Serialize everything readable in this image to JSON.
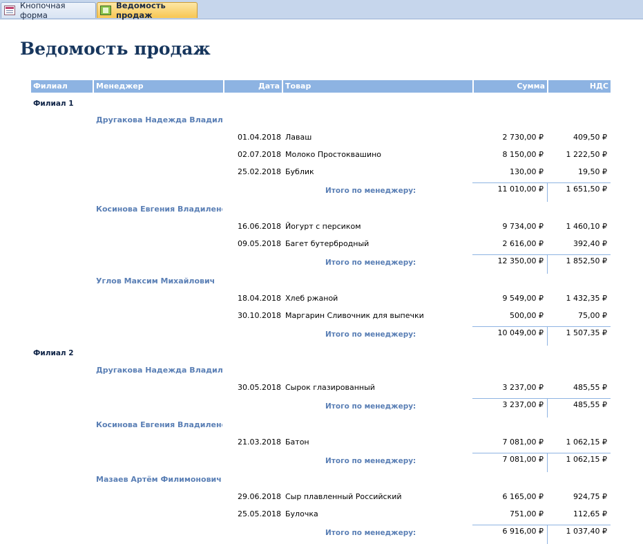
{
  "tabs": [
    {
      "label": "Кнопочная форма",
      "icon": "form-icon"
    },
    {
      "label": "Ведомость продаж",
      "icon": "report-icon"
    }
  ],
  "report_title": "Ведомость продаж",
  "columns": {
    "branch": "Филиал",
    "manager": "Менеджер",
    "date": "Дата",
    "product": "Товар",
    "sum": "Сумма",
    "vat": "НДС"
  },
  "subtotal_label": "Итого по менеджеру:",
  "branches": [
    {
      "name": "Филиал 1",
      "managers": [
        {
          "name": "Другакова Надежда Владиленовна",
          "rows": [
            {
              "date": "01.04.2018",
              "product": "Лаваш",
              "sum": "2 730,00 ₽",
              "vat": "409,50 ₽"
            },
            {
              "date": "02.07.2018",
              "product": "Молоко Простоквашино",
              "sum": "8 150,00 ₽",
              "vat": "1 222,50 ₽"
            },
            {
              "date": "25.02.2018",
              "product": "Бублик",
              "sum": "130,00 ₽",
              "vat": "19,50 ₽"
            }
          ],
          "total_sum": "11 010,00 ₽",
          "total_vat": "1 651,50 ₽"
        },
        {
          "name": "Косинова Евгения Владиленовна",
          "rows": [
            {
              "date": "16.06.2018",
              "product": "Йогурт с персиком",
              "sum": "9 734,00 ₽",
              "vat": "1 460,10 ₽"
            },
            {
              "date": "09.05.2018",
              "product": "Багет бутербродный",
              "sum": "2 616,00 ₽",
              "vat": "392,40 ₽"
            }
          ],
          "total_sum": "12 350,00 ₽",
          "total_vat": "1 852,50 ₽"
        },
        {
          "name": "Углов Максим Михайлович",
          "rows": [
            {
              "date": "18.04.2018",
              "product": "Хлеб ржаной",
              "sum": "9 549,00 ₽",
              "vat": "1 432,35 ₽"
            },
            {
              "date": "30.10.2018",
              "product": "Маргарин Сливочник для выпечки",
              "sum": "500,00 ₽",
              "vat": "75,00 ₽"
            }
          ],
          "total_sum": "10 049,00 ₽",
          "total_vat": "1 507,35 ₽"
        }
      ]
    },
    {
      "name": "Филиал 2",
      "managers": [
        {
          "name": "Другакова Надежда Владиленовна",
          "rows": [
            {
              "date": "30.05.2018",
              "product": "Сырок глазированный",
              "sum": "3 237,00 ₽",
              "vat": "485,55 ₽"
            }
          ],
          "total_sum": "3 237,00 ₽",
          "total_vat": "485,55 ₽"
        },
        {
          "name": "Косинова Евгения Владиленовна",
          "rows": [
            {
              "date": "21.03.2018",
              "product": "Батон",
              "sum": "7 081,00 ₽",
              "vat": "1 062,15 ₽"
            }
          ],
          "total_sum": "7 081,00 ₽",
          "total_vat": "1 062,15 ₽"
        },
        {
          "name": "Мазаев Артём Филимонович",
          "rows": [
            {
              "date": "29.06.2018",
              "product": "Сыр плавленный Российский",
              "sum": "6 165,00 ₽",
              "vat": "924,75 ₽"
            },
            {
              "date": "25.05.2018",
              "product": "Булочка",
              "sum": "751,00 ₽",
              "vat": "112,65 ₽"
            }
          ],
          "total_sum": "6 916,00 ₽",
          "total_vat": "1 037,40 ₽"
        }
      ]
    }
  ]
}
